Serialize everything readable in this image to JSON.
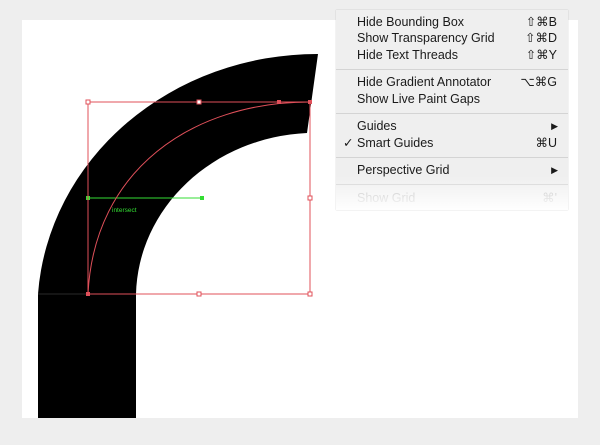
{
  "menu": {
    "items": [
      {
        "label": "Hide Bounding Box",
        "shortcut": "⇧⌘B"
      },
      {
        "label": "Show Transparency Grid",
        "shortcut": "⇧⌘D"
      },
      {
        "label": "Hide Text Threads",
        "shortcut": "⇧⌘Y"
      },
      {
        "label": "Hide Gradient Annotator",
        "shortcut": "⌥⌘G"
      },
      {
        "label": "Show Live Paint Gaps",
        "shortcut": ""
      },
      {
        "label": "Guides",
        "shortcut": "",
        "submenu": true
      },
      {
        "label": "Smart Guides",
        "shortcut": "⌘U",
        "checked": true
      },
      {
        "label": "Perspective Grid",
        "shortcut": "",
        "submenu": true
      },
      {
        "label": "Show Grid",
        "shortcut": "⌘'"
      }
    ],
    "checkmark": "✓",
    "submenu_arrow": "▶"
  },
  "canvas": {
    "smart_guide_label": "intersect",
    "shape_color": "#000000",
    "selection_color": "#e0505a",
    "guide_color": "#33dd33"
  }
}
